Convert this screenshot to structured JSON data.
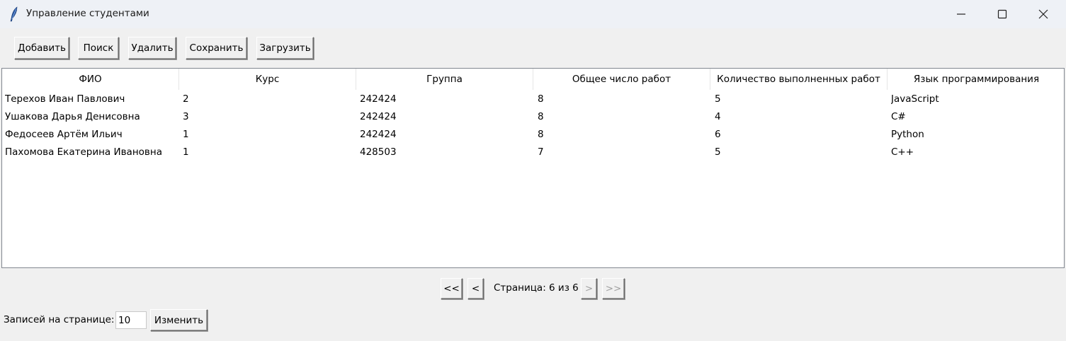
{
  "window": {
    "title": "Управление студентами"
  },
  "toolbar": {
    "add": "Добавить",
    "search": "Поиск",
    "delete": "Удалить",
    "save": "Сохранить",
    "load": "Загрузить"
  },
  "table": {
    "columns": [
      "ФИО",
      "Курс",
      "Группа",
      "Общее число работ",
      "Количество выполненных работ",
      "Язык программирования"
    ],
    "rows": [
      [
        "Терехов Иван Павлович",
        "2",
        "242424",
        "8",
        "5",
        "JavaScript"
      ],
      [
        "Ушакова Дарья Денисовна",
        "3",
        "242424",
        "8",
        "4",
        "C#"
      ],
      [
        "Федосеев Артём Ильич",
        "1",
        "242424",
        "8",
        "6",
        "Python"
      ],
      [
        "Пахомова Екатерина Ивановна",
        "1",
        "428503",
        "7",
        "5",
        "C++"
      ]
    ]
  },
  "pager": {
    "first": "<<",
    "prev": "<",
    "label": "Страница: 6 из 6",
    "next": ">",
    "last": ">>"
  },
  "per_page": {
    "label": "Записей на странице:",
    "value": "10",
    "apply": "Изменить"
  }
}
